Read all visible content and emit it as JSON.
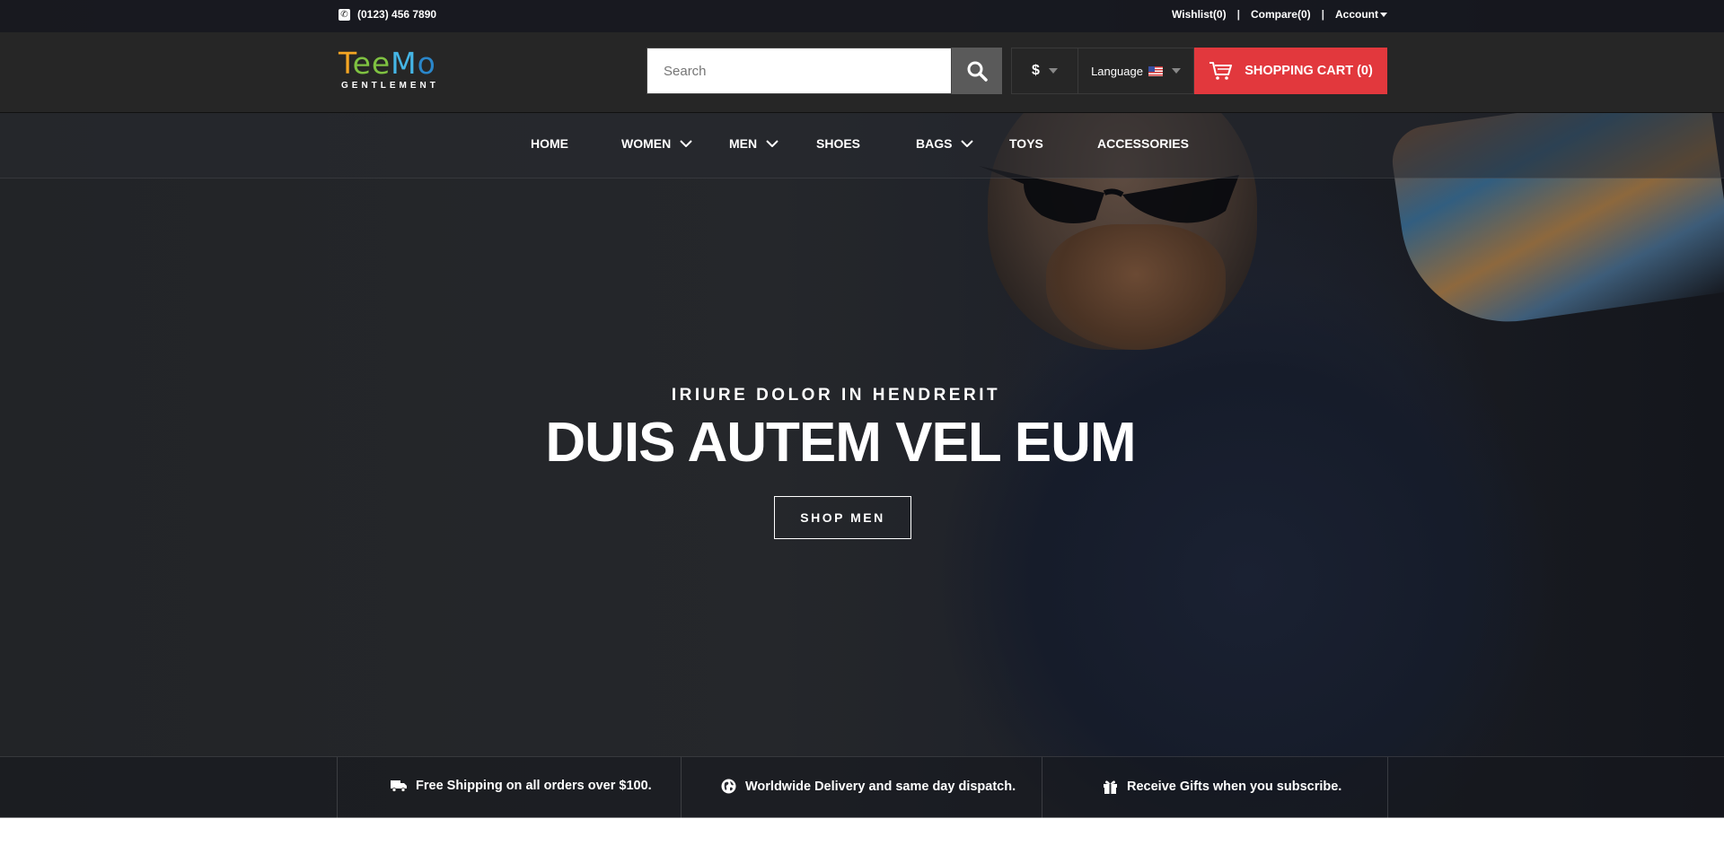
{
  "topbar": {
    "phone": "(0123) 456 7890",
    "links": [
      "Wishlist(0)",
      "Compare(0)",
      "Account"
    ],
    "separator": "|"
  },
  "header": {
    "logo": {
      "letters": [
        "T",
        "ee",
        "M",
        "o"
      ],
      "tagline": "GENTLEMENT"
    },
    "search": {
      "placeholder": "Search",
      "value": ""
    },
    "currency": "$",
    "language": "Language",
    "cart_label": "SHOPPING CART (0)",
    "cart_color": "#e2383d"
  },
  "nav": {
    "items": [
      "HOME",
      "WOMEN",
      "MEN",
      "SHOES",
      "BAGS",
      "TOYS",
      "ACCESSORIES"
    ]
  },
  "hero": {
    "subtitle": "IRIURE DOLOR IN HENDRERIT",
    "title": "DUIS AUTEM VEL EUM",
    "button": "SHOP MEN"
  },
  "features": [
    {
      "icon": "truck-icon",
      "text": "Free Shipping on all orders over $100."
    },
    {
      "icon": "globe-icon",
      "text": "Worldwide Delivery and same day dispatch."
    },
    {
      "icon": "gift-icon",
      "text": "Receive Gifts when you subscribe."
    }
  ]
}
